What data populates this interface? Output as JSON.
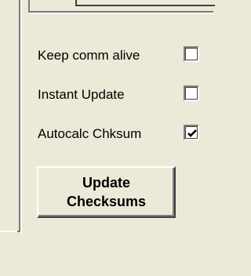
{
  "options": [
    {
      "label": "Keep comm alive",
      "checked": false
    },
    {
      "label": "Instant Update",
      "checked": false
    },
    {
      "label": "Autocalc Chksum",
      "checked": true
    }
  ],
  "update_button": {
    "line1": "Update",
    "line2": "Checksums"
  },
  "colors": {
    "background": "#ece9d8",
    "shadow": "#808080",
    "dark_shadow": "#404040",
    "highlight": "#ffffff"
  }
}
